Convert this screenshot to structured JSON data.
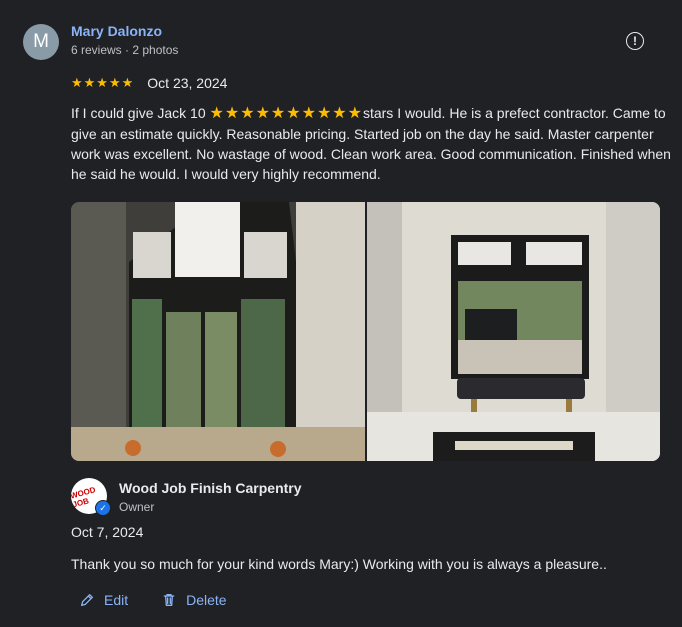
{
  "reviewer": {
    "initial": "M",
    "name": "Mary Dalonzo",
    "meta": "6 reviews · 2 photos"
  },
  "review": {
    "rating": 5,
    "stars": "★★★★★",
    "date": "Oct 23, 2024",
    "text_before": "If I could give Jack 10 ",
    "inline_stars": "★★★★★★★★★★",
    "text_after": "stars I would. He is a prefect contractor. Came to give an estimate quickly. Reasonable pricing. Started job on the day he said. Master carpenter work was excellent. No wastage of wood. Clean work area. Good communication. Finished when he said he would. I would very highly recommend."
  },
  "photos": [
    {
      "id": "photo-1",
      "icon": "window-doors-photo"
    },
    {
      "id": "photo-2",
      "icon": "window-bench-photo"
    }
  ],
  "owner": {
    "logo_text": "WOOD JOB",
    "name": "Wood Job Finish Carpentry",
    "role": "Owner",
    "reply_date": "Oct 7, 2024",
    "reply_text": "Thank you so much for your kind words Mary:) Working with you is always a pleasure.."
  },
  "actions": {
    "edit_label": "Edit",
    "delete_label": "Delete"
  },
  "colors": {
    "background": "#202124",
    "accent": "#8ab4f8",
    "star": "#fbbc04"
  }
}
